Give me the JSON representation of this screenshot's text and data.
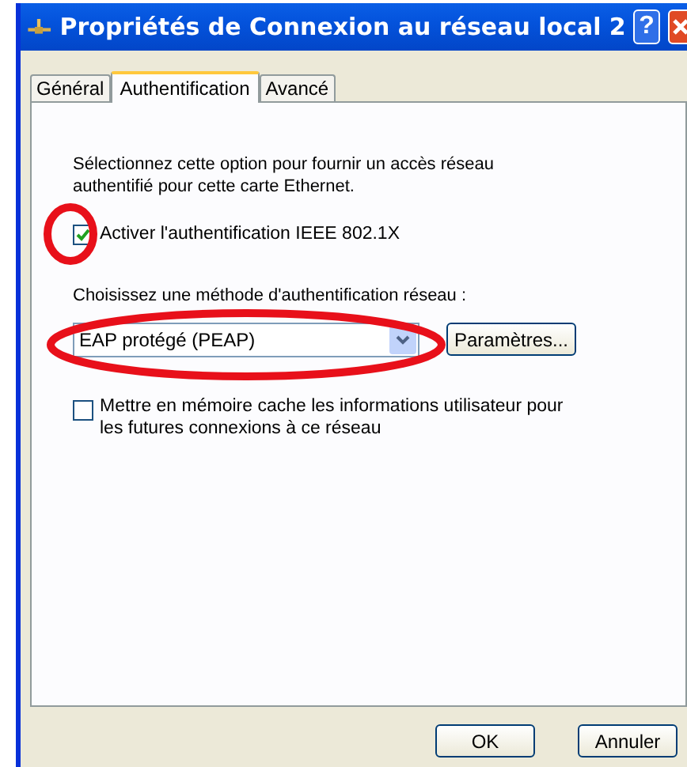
{
  "window": {
    "title": "Propriétés de Connexion au réseau local 2",
    "help": "?"
  },
  "tabs": [
    {
      "label": "Général",
      "selected": false
    },
    {
      "label": "Authentification",
      "selected": true
    },
    {
      "label": "Avancé",
      "selected": false
    }
  ],
  "description": "Sélectionnez cette option pour fournir un accès réseau authentifié pour cette carte Ethernet.",
  "enable_checkbox": {
    "label": "Activer l'authentification IEEE 802.1X",
    "checked": true,
    "circled": true
  },
  "method_label": "Choisissez une méthode d'authentification réseau :",
  "method_select": {
    "value": "EAP protégé (PEAP)",
    "circled": true
  },
  "settings_button": "Paramètres...",
  "cache_checkbox": {
    "label": "Mettre en mémoire cache les informations utilisateur pour les futures connexions à ce réseau",
    "checked": false
  },
  "buttons": [
    "OK",
    "Annuler"
  ]
}
